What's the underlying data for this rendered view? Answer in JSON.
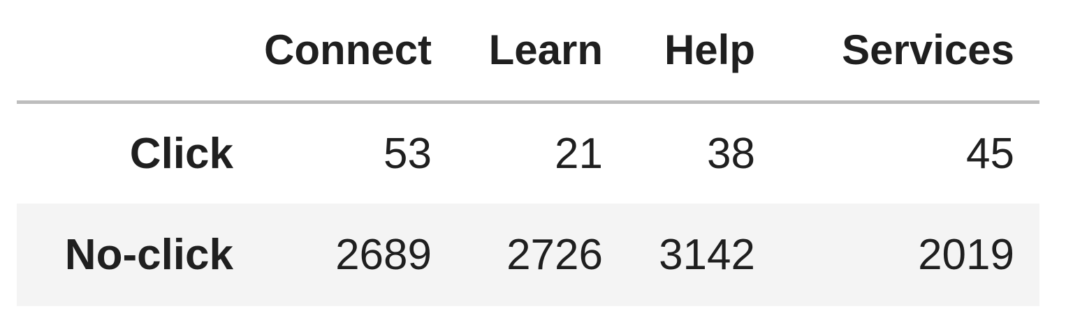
{
  "chart_data": {
    "type": "table",
    "columns": [
      "Connect",
      "Learn",
      "Help",
      "Services"
    ],
    "rows": [
      {
        "label": "Click",
        "values": [
          "53",
          "21",
          "38",
          "45"
        ]
      },
      {
        "label": "No-click",
        "values": [
          "2689",
          "2726",
          "3142",
          "2019"
        ]
      }
    ]
  }
}
